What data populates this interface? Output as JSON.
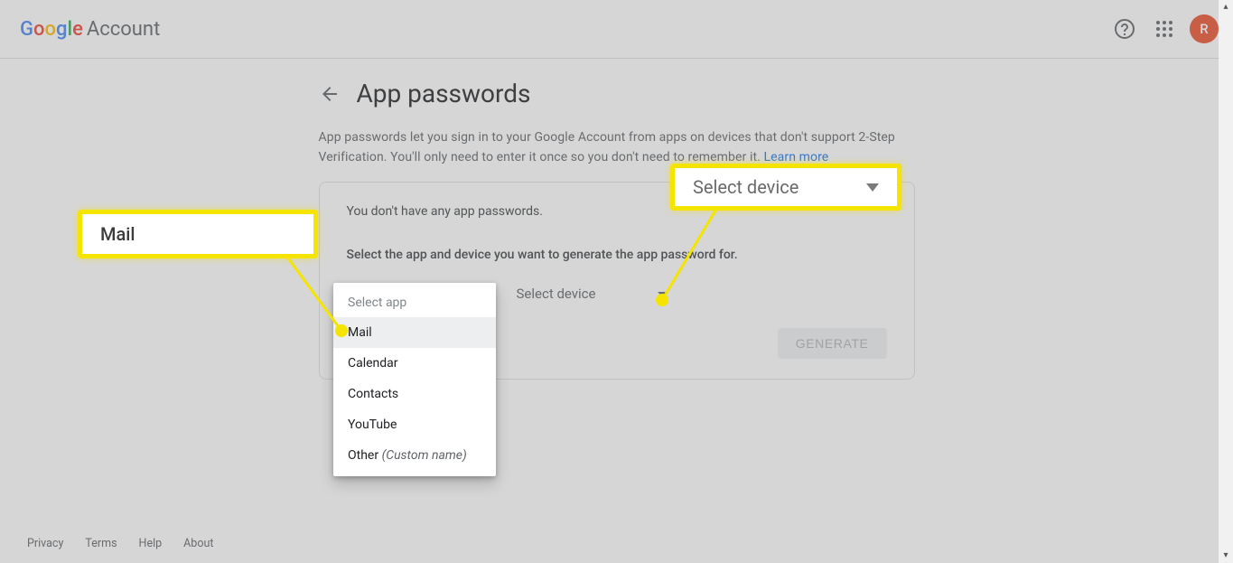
{
  "header": {
    "logo_brand": "Google",
    "logo_product": "Account",
    "avatar_initial": "R"
  },
  "page": {
    "title": "App passwords",
    "intro": "App passwords let you sign in to your Google Account from apps on devices that don't support 2-Step Verification. You'll only need to enter it once so you don't need to remember it. ",
    "learn_more": "Learn more"
  },
  "card": {
    "empty_msg": "You don't have any app passwords.",
    "instruction": "Select the app and device you want to generate the app password for.",
    "select_app_label": "Select app",
    "select_device_label": "Select device",
    "generate_label": "GENERATE"
  },
  "dropdown": {
    "header": "Select app",
    "items": [
      "Mail",
      "Calendar",
      "Contacts",
      "YouTube"
    ],
    "other_label": "Other ",
    "other_custom": "(Custom name)"
  },
  "callouts": {
    "mail": "Mail",
    "device": "Select device"
  },
  "footer": {
    "privacy": "Privacy",
    "terms": "Terms",
    "help": "Help",
    "about": "About"
  }
}
